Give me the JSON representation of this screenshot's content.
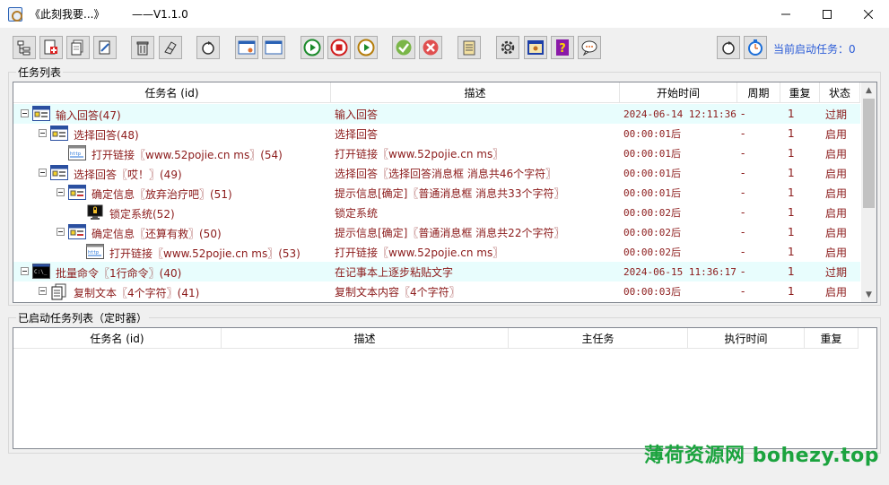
{
  "window": {
    "title": "《此刻我要...》        ——V1.1.0",
    "controls": [
      "minimize",
      "maximize",
      "close"
    ]
  },
  "toolbar": {
    "buttons": [
      "tree-icon",
      "add-task-icon",
      "copy-task-icon",
      "edit-task-icon",
      "delete-icon",
      "clear-icon",
      "refresh-icon",
      "window-small-icon",
      "window-icon",
      "play-icon",
      "stop-icon",
      "play-next-icon",
      "check-icon",
      "cancel-icon",
      "notepad-icon",
      "settings-icon",
      "screen-icon",
      "help-icon",
      "chat-icon",
      "reload-icon",
      "timer-icon"
    ],
    "running_label": "当前启动任务：0"
  },
  "task_list": {
    "group_title": "任务列表",
    "columns": [
      "任务名 (id)",
      "描述",
      "开始时间",
      "周期",
      "重复",
      "状态"
    ],
    "rows": [
      {
        "level": 0,
        "icon": "dialog-icon",
        "name": "输入回答(47)",
        "desc": "输入回答",
        "time": "2024-06-14 12:11:36",
        "period": "-",
        "repeat": "1",
        "status": "过期",
        "highlight": true,
        "expander": true
      },
      {
        "level": 1,
        "icon": "dialog-icon",
        "name": "选择回答(48)",
        "desc": "选择回答",
        "time": "00:00:01后",
        "period": "-",
        "repeat": "1",
        "status": "启用",
        "highlight": false,
        "expander": true
      },
      {
        "level": 2,
        "icon": "link-icon",
        "name": "打开链接〖www.52pojie.cn ms〗(54)",
        "desc": "打开链接〖www.52pojie.cn ms〗",
        "time": "00:00:01后",
        "period": "-",
        "repeat": "1",
        "status": "启用",
        "highlight": false,
        "expander": false
      },
      {
        "level": 1,
        "icon": "dialog-icon",
        "name": "选择回答〖哎！〗(49)",
        "desc": "选择回答〖选择回答消息框 消息共46个字符〗",
        "time": "00:00:01后",
        "period": "-",
        "repeat": "1",
        "status": "启用",
        "highlight": false,
        "expander": true
      },
      {
        "level": 2,
        "icon": "message-icon",
        "name": "确定信息〖放弃治疗吧〗(51)",
        "desc": "提示信息[确定]〖普通消息框 消息共33个字符〗",
        "time": "00:00:01后",
        "period": "-",
        "repeat": "1",
        "status": "启用",
        "highlight": false,
        "expander": true
      },
      {
        "level": 3,
        "icon": "lock-icon",
        "name": "锁定系统(52)",
        "desc": "锁定系统",
        "time": "00:00:02后",
        "period": "-",
        "repeat": "1",
        "status": "启用",
        "highlight": false,
        "expander": false
      },
      {
        "level": 2,
        "icon": "message-icon",
        "name": "确定信息〖还算有救〗(50)",
        "desc": "提示信息[确定]〖普通消息框 消息共22个字符〗",
        "time": "00:00:02后",
        "period": "-",
        "repeat": "1",
        "status": "启用",
        "highlight": false,
        "expander": true
      },
      {
        "level": 3,
        "icon": "link-icon",
        "name": "打开链接〖www.52pojie.cn ms〗(53)",
        "desc": "打开链接〖www.52pojie.cn ms〗",
        "time": "00:00:02后",
        "period": "-",
        "repeat": "1",
        "status": "启用",
        "highlight": false,
        "expander": false
      },
      {
        "level": 0,
        "icon": "console-icon",
        "name": "批量命令〖1行命令〗(40)",
        "desc": "在记事本上逐步粘贴文字",
        "time": "2024-06-15 11:36:17",
        "period": "-",
        "repeat": "1",
        "status": "过期",
        "highlight": true,
        "expander": true
      },
      {
        "level": 1,
        "icon": "copy-text-icon",
        "name": "复制文本〖4个字符〗(41)",
        "desc": "复制文本内容〖4个字符〗",
        "time": "00:00:03后",
        "period": "-",
        "repeat": "1",
        "status": "启用",
        "highlight": false,
        "expander": true
      }
    ]
  },
  "timer_list": {
    "group_title": "已启动任务列表（定时器）",
    "columns": [
      "任务名 (id)",
      "描述",
      "主任务",
      "执行时间",
      "重复"
    ]
  },
  "watermark": "薄荷资源网 bohezy.top"
}
